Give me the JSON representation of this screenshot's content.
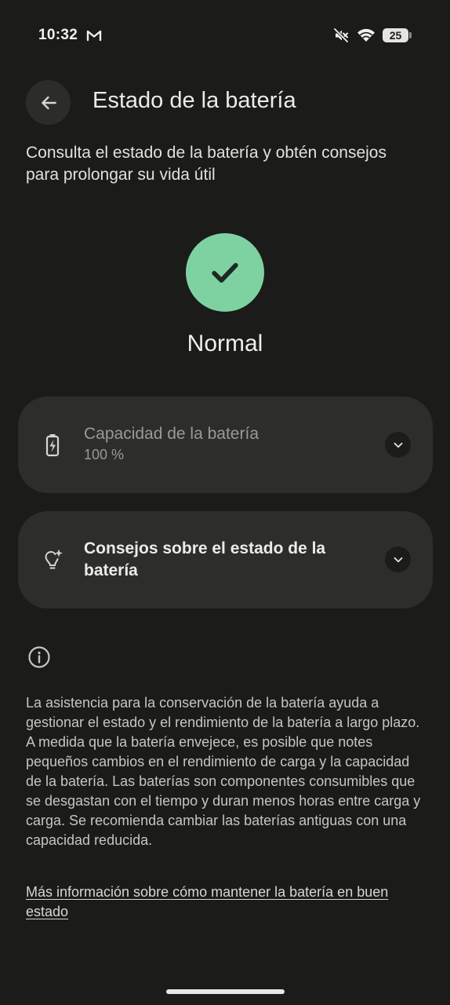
{
  "status_bar": {
    "time": "10:32",
    "battery_level": "25",
    "icons": [
      "gmail-icon",
      "mute-icon",
      "wifi-icon",
      "battery-icon"
    ]
  },
  "header": {
    "back_icon": "arrow-back-icon",
    "title": "Estado de la batería"
  },
  "subtitle": "Consulta el estado de la batería y obtén consejos para prolongar su vida útil",
  "health": {
    "status": "Normal",
    "icon": "check-icon",
    "color": "#7ed2a1"
  },
  "cards": {
    "capacity": {
      "icon": "battery-charging-icon",
      "title": "Capacidad de la batería",
      "value": "100 %",
      "expand_icon": "chevron-down-icon"
    },
    "tips": {
      "icon": "lightbulb-sparkle-icon",
      "title": "Consejos sobre el estado de la batería",
      "expand_icon": "chevron-down-icon"
    }
  },
  "info": {
    "icon": "info-icon",
    "text": "La asistencia para la conservación de la batería ayuda a gestionar el estado y el rendimiento de la batería a largo plazo. A medida que la batería envejece, es posible que notes pequeños cambios en el rendimiento de carga y la capacidad de la batería. Las baterías son componentes consumibles que se desgastan con el tiempo y duran menos horas entre carga y carga. Se recomienda cambiar las baterías antiguas con una capacidad reducida.",
    "link": "Más información sobre cómo mantener la batería en buen estado"
  }
}
